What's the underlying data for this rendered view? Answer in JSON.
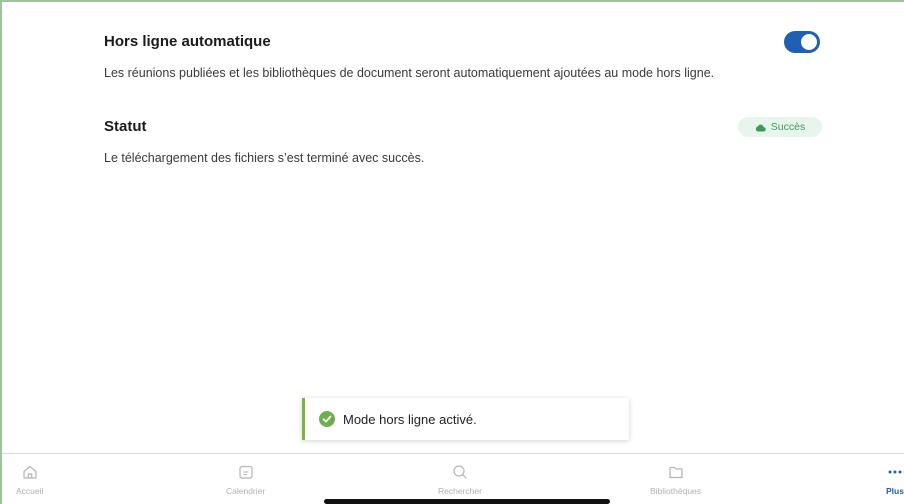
{
  "offline": {
    "title": "Hors ligne automatique",
    "description": "Les réunions publiées et les bibliothèques de document seront automatiquement ajoutées au mode hors ligne.",
    "enabled": true
  },
  "status": {
    "title": "Statut",
    "badge": "Succès",
    "description": "Le téléchargement des fichiers s’est terminé avec succès."
  },
  "toast": {
    "message": "Mode hors ligne activé."
  },
  "tabbar": {
    "items": [
      {
        "label": "Accueil",
        "icon": "home-icon"
      },
      {
        "label": "Calendrier",
        "icon": "calendar-icon"
      },
      {
        "label": "Rechercher",
        "icon": "search-icon"
      },
      {
        "label": "Bibliothèques",
        "icon": "folder-icon"
      },
      {
        "label": "Plus",
        "icon": "more-icon",
        "active": true
      }
    ]
  },
  "colors": {
    "accent": "#1f5fb4",
    "success": "#3d9a5b",
    "toast_bar": "#7cb342"
  }
}
